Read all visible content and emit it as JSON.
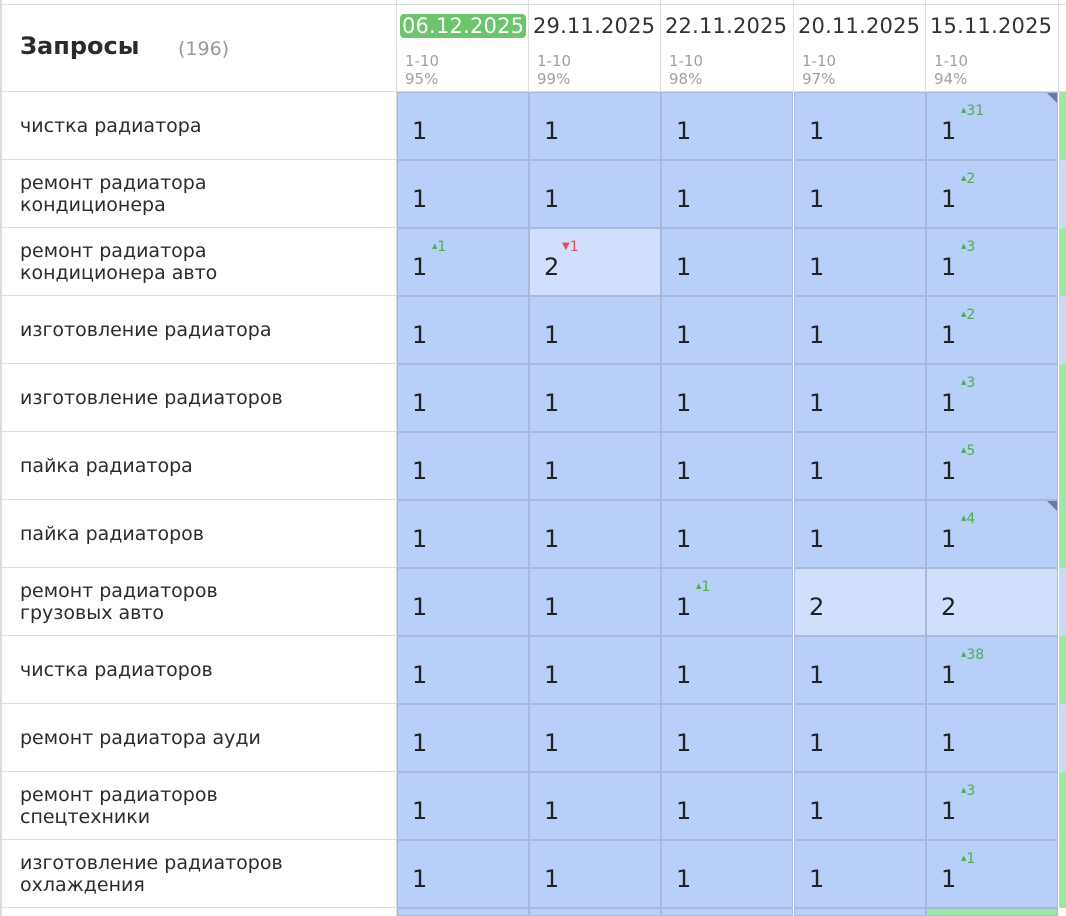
{
  "header": {
    "title": "Запросы",
    "count": "(196)"
  },
  "columns": [
    {
      "date": "06.12.2025",
      "top": "1-10",
      "pct": "95%",
      "active": true
    },
    {
      "date": "29.11.2025",
      "top": "1-10",
      "pct": "99%",
      "active": false
    },
    {
      "date": "22.11.2025",
      "top": "1-10",
      "pct": "98%",
      "active": false
    },
    {
      "date": "20.11.2025",
      "top": "1-10",
      "pct": "97%",
      "active": false
    },
    {
      "date": "15.11.2025",
      "top": "1-10",
      "pct": "94%",
      "active": false
    }
  ],
  "rows": [
    {
      "query": [
        "чистка радиатора"
      ],
      "cells": [
        {
          "v": "1"
        },
        {
          "v": "1"
        },
        {
          "v": "1"
        },
        {
          "v": "1"
        },
        {
          "v": "1",
          "d": "31",
          "dir": "up",
          "corner": true
        }
      ],
      "edge": "g"
    },
    {
      "query": [
        "ремонт радиатора",
        "кондиционера"
      ],
      "cells": [
        {
          "v": "1"
        },
        {
          "v": "1"
        },
        {
          "v": "1"
        },
        {
          "v": "1"
        },
        {
          "v": "1",
          "d": "2",
          "dir": "up"
        }
      ],
      "edge": "b"
    },
    {
      "query": [
        "ремонт радиатора",
        "кондиционера авто"
      ],
      "cells": [
        {
          "v": "1",
          "d": "1",
          "dir": "up"
        },
        {
          "v": "2",
          "d": "1",
          "dir": "down"
        },
        {
          "v": "1"
        },
        {
          "v": "1"
        },
        {
          "v": "1",
          "d": "3",
          "dir": "up"
        }
      ],
      "edge": "g"
    },
    {
      "query": [
        "изготовление радиатора"
      ],
      "cells": [
        {
          "v": "1"
        },
        {
          "v": "1"
        },
        {
          "v": "1"
        },
        {
          "v": "1"
        },
        {
          "v": "1",
          "d": "2",
          "dir": "up"
        }
      ],
      "edge": "b"
    },
    {
      "query": [
        "изготовление радиаторов"
      ],
      "cells": [
        {
          "v": "1"
        },
        {
          "v": "1"
        },
        {
          "v": "1"
        },
        {
          "v": "1"
        },
        {
          "v": "1",
          "d": "3",
          "dir": "up"
        }
      ],
      "edge": "g"
    },
    {
      "query": [
        "пайка радиатора"
      ],
      "cells": [
        {
          "v": "1"
        },
        {
          "v": "1"
        },
        {
          "v": "1"
        },
        {
          "v": "1"
        },
        {
          "v": "1",
          "d": "5",
          "dir": "up"
        }
      ],
      "edge": "g"
    },
    {
      "query": [
        "пайка радиаторов"
      ],
      "cells": [
        {
          "v": "1"
        },
        {
          "v": "1"
        },
        {
          "v": "1"
        },
        {
          "v": "1"
        },
        {
          "v": "1",
          "d": "4",
          "dir": "up",
          "corner": true
        }
      ],
      "edge": "g"
    },
    {
      "query": [
        "ремонт радиаторов",
        "грузовых авто"
      ],
      "cells": [
        {
          "v": "1"
        },
        {
          "v": "1"
        },
        {
          "v": "1",
          "d": "1",
          "dir": "up"
        },
        {
          "v": "2"
        },
        {
          "v": "2"
        }
      ],
      "edge": "b"
    },
    {
      "query": [
        "чистка радиаторов"
      ],
      "cells": [
        {
          "v": "1"
        },
        {
          "v": "1"
        },
        {
          "v": "1"
        },
        {
          "v": "1"
        },
        {
          "v": "1",
          "d": "38",
          "dir": "up"
        }
      ],
      "edge": "g"
    },
    {
      "query": [
        "ремонт радиатора ауди"
      ],
      "cells": [
        {
          "v": "1"
        },
        {
          "v": "1"
        },
        {
          "v": "1"
        },
        {
          "v": "1"
        },
        {
          "v": "1"
        }
      ],
      "edge": "b"
    },
    {
      "query": [
        "ремонт радиаторов",
        "спецтехники"
      ],
      "cells": [
        {
          "v": "1"
        },
        {
          "v": "1"
        },
        {
          "v": "1"
        },
        {
          "v": "1"
        },
        {
          "v": "1",
          "d": "3",
          "dir": "up"
        }
      ],
      "edge": "g"
    },
    {
      "query": [
        "изготовление радиаторов",
        "охлаждения"
      ],
      "cells": [
        {
          "v": "1"
        },
        {
          "v": "1"
        },
        {
          "v": "1"
        },
        {
          "v": "1"
        },
        {
          "v": "1",
          "d": "1",
          "dir": "up"
        }
      ],
      "edge": "g"
    }
  ],
  "colors": {
    "position_1": "#b8cff9",
    "position_2": "#d0dffc",
    "active_date": "#6cc46c",
    "delta_up": "#4cae4c",
    "delta_down": "#d9534f"
  }
}
